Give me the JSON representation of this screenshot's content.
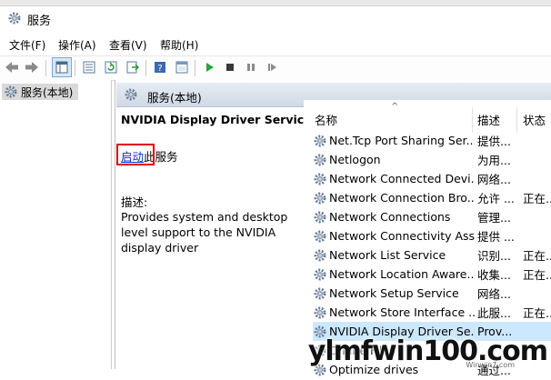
{
  "window": {
    "title": "服务"
  },
  "menu": [
    "文件(F)",
    "操作(A)",
    "查看(V)",
    "帮助(H)"
  ],
  "toolbar": {
    "icons": [
      "back-icon",
      "forward-icon",
      "show-tree-icon",
      "properties-icon",
      "refresh-icon",
      "export-icon",
      "help-icon",
      "console-icon",
      "play-icon",
      "stop-icon",
      "pause-icon",
      "restart-icon"
    ]
  },
  "tree": {
    "root": "服务(本地)"
  },
  "pane": {
    "header": "服务(本地)",
    "service_title": "NVIDIA Display Driver Service",
    "start_link": "启动",
    "start_suffix": "此服务",
    "desc_label": "描述:",
    "desc_text": "Provides system and desktop level support to the NVIDIA display driver"
  },
  "list": {
    "columns": {
      "name": "名称",
      "desc": "描述",
      "status": "状态"
    },
    "rows": [
      {
        "name": "Net.Tcp Port Sharing Ser...",
        "desc": "提供...",
        "status": ""
      },
      {
        "name": "Netlogon",
        "desc": "为用...",
        "status": ""
      },
      {
        "name": "Network Connected Devi...",
        "desc": "网络...",
        "status": ""
      },
      {
        "name": "Network Connection Bro...",
        "desc": "允许 ...",
        "status": "正在..."
      },
      {
        "name": "Network Connections",
        "desc": "管理...",
        "status": ""
      },
      {
        "name": "Network Connectivity Ass...",
        "desc": "提供 ...",
        "status": ""
      },
      {
        "name": "Network List Service",
        "desc": "识别...",
        "status": "正在..."
      },
      {
        "name": "Network Location Aware...",
        "desc": "收集...",
        "status": "正在..."
      },
      {
        "name": "Network Setup Service",
        "desc": "网络...",
        "status": ""
      },
      {
        "name": "Network Store Interface ...",
        "desc": "此服...",
        "status": "正在..."
      },
      {
        "name": "NVIDIA Display Driver Se...",
        "desc": "Prov...",
        "status": ""
      },
      {
        "name": "Offline Files",
        "desc": "",
        "status": ""
      },
      {
        "name": "Optimize drives",
        "desc": "通过...",
        "status": ""
      }
    ]
  },
  "watermark": {
    "text": "ylmfwin100.com",
    "sub": "Winwin7.com"
  },
  "colors": {
    "selection": "#cce8ff",
    "link": "#0033cc",
    "highlight_box": "#e00000",
    "header_gradient_top": "#e6ecf3"
  }
}
